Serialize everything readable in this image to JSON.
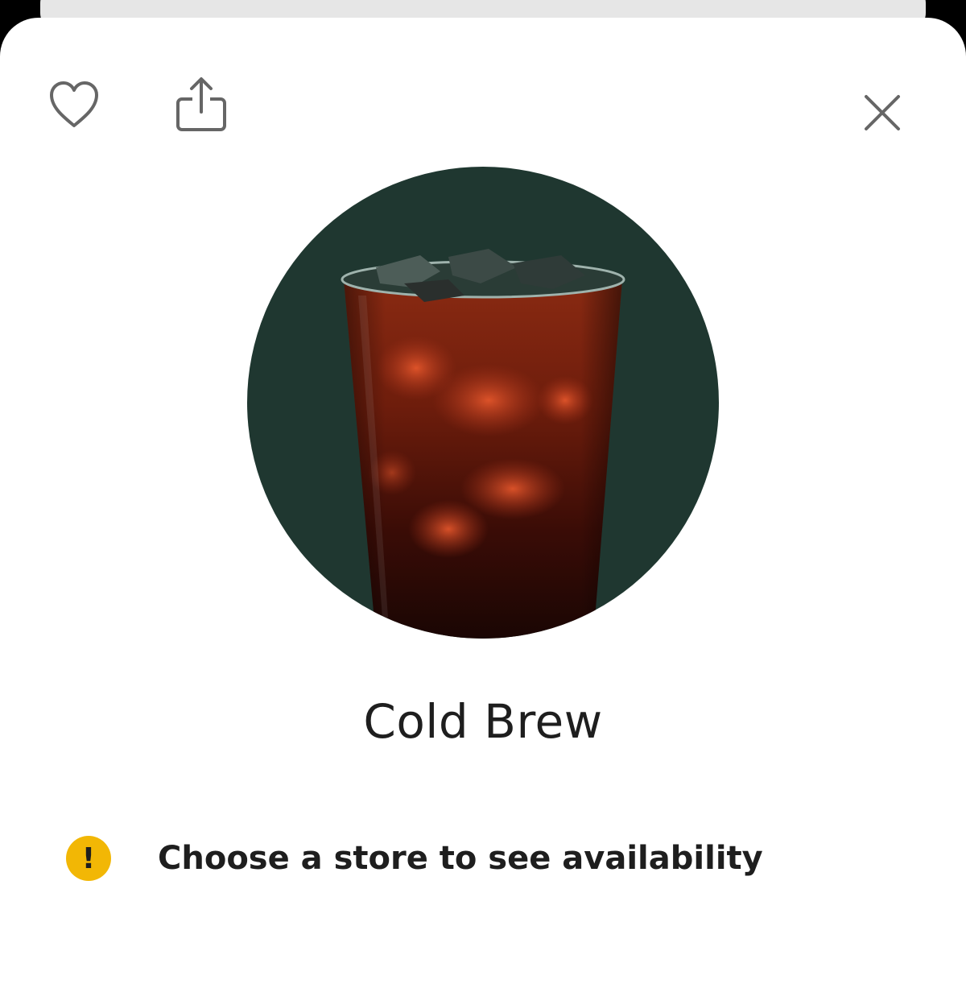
{
  "colors": {
    "sheet_background": "#ffffff",
    "hero_background": "#1f3730",
    "warning_accent": "#f2b705",
    "text_primary": "#1e1e1e",
    "icon_gray": "#666666"
  },
  "header": {
    "favorite_icon": "heart-outline-icon",
    "share_icon": "share-icon",
    "close_icon": "close-icon"
  },
  "product": {
    "name": "Cold Brew",
    "image": "iced-coffee-glass"
  },
  "availability_notice": {
    "icon": "exclamation-icon",
    "icon_glyph": "!",
    "text": "Choose a store to see availability"
  }
}
